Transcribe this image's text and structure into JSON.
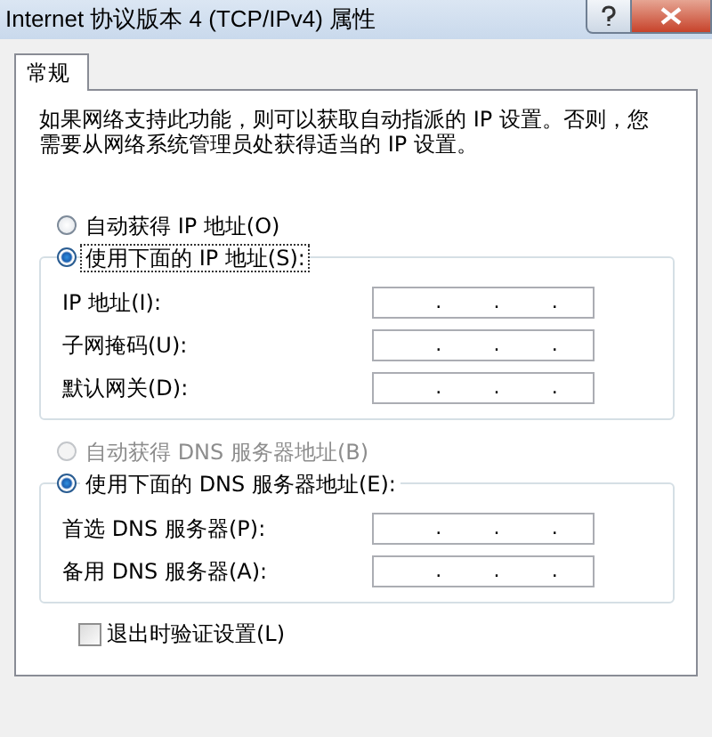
{
  "window": {
    "title": "Internet 协议版本 4 (TCP/IPv4) 属性"
  },
  "tabs": [
    {
      "label": "常规",
      "selected": true
    }
  ],
  "description": "如果网络支持此功能，则可以获取自动指派的 IP 设置。否则，您需要从网络系统管理员处获得适当的 IP 设置。",
  "sections": [
    {
      "options": [
        {
          "label": "自动获得 IP 地址(O)",
          "selected": false,
          "disabled": false,
          "focused": false
        },
        {
          "label": "使用下面的 IP 地址(S):",
          "selected": true,
          "disabled": false,
          "focused": true
        }
      ],
      "fields": [
        {
          "label": "IP 地址(I):",
          "separators": [
            ".",
            ".",
            "."
          ]
        },
        {
          "label": "子网掩码(U):",
          "separators": [
            ".",
            ".",
            "."
          ]
        },
        {
          "label": "默认网关(D):",
          "separators": [
            ".",
            ".",
            "."
          ]
        }
      ]
    },
    {
      "options": [
        {
          "label": "自动获得 DNS 服务器地址(B)",
          "selected": false,
          "disabled": true,
          "focused": false
        },
        {
          "label": "使用下面的 DNS 服务器地址(E):",
          "selected": true,
          "disabled": false,
          "focused": false
        }
      ],
      "fields": [
        {
          "label": "首选 DNS 服务器(P):",
          "separators": [
            ".",
            ".",
            "."
          ]
        },
        {
          "label": "备用 DNS 服务器(A):",
          "separators": [
            ".",
            ".",
            "."
          ]
        }
      ]
    }
  ],
  "validate_on_exit": {
    "label": "退出时验证设置(L)",
    "checked": false
  }
}
